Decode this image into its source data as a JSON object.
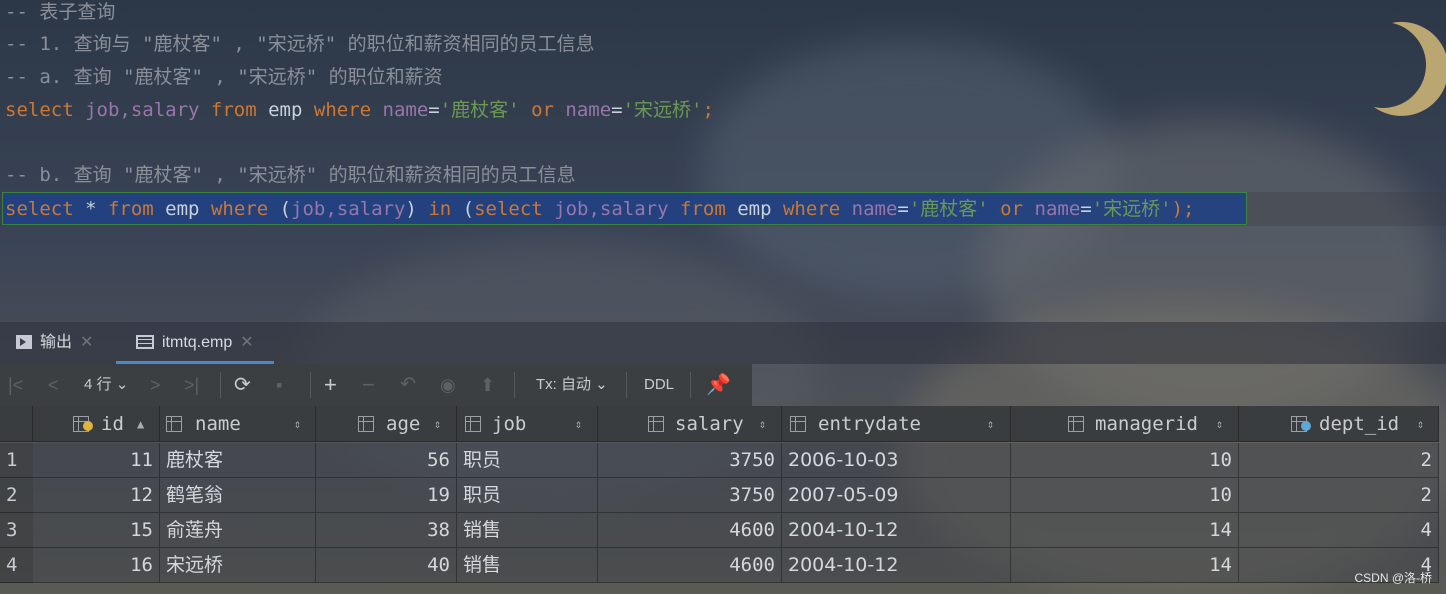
{
  "editor": {
    "comment1": "-- 表子查询",
    "comment2": "-- 1. 查询与 \"鹿杖客\" , \"宋远桥\" 的职位和薪资相同的员工信息",
    "comment3": "-- a. 查询 \"鹿杖客\" , \"宋远桥\" 的职位和薪资",
    "sql1": {
      "select": "select ",
      "cols": "job,salary",
      "from": " from ",
      "table": "emp",
      "where": " where ",
      "name1": "name",
      "eq1": "=",
      "v1": "'鹿杖客'",
      "or": " or ",
      "name2": "name",
      "eq2": "=",
      "v2": "'宋远桥'",
      "end": ";"
    },
    "comment4": "-- b. 查询 \"鹿杖客\" , \"宋远桥\" 的职位和薪资相同的员工信息",
    "sql2": {
      "select": "select",
      "star": " * ",
      "from": "from",
      "table": " emp ",
      "where": "where",
      "lp": " (",
      "cols": "job,salary",
      "rp": ") ",
      "in": "in",
      "lp2": " (",
      "select2": "select",
      "cols2": " job,salary ",
      "from2": "from",
      "table2": " emp ",
      "where2": "where",
      "name1": " name",
      "eq1": "=",
      "v1": "'鹿杖客'",
      "or": " or",
      "name2": " name",
      "eq2": "=",
      "v2": "'宋远桥'",
      "end": ");"
    }
  },
  "tabs": {
    "output": "输出",
    "table": "itmtq.emp"
  },
  "toolbar": {
    "rows": "4 行",
    "tx": "Tx: 自动",
    "ddl": "DDL"
  },
  "grid": {
    "columns": [
      "id",
      "name",
      "age",
      "job",
      "salary",
      "entrydate",
      "managerid",
      "dept_id"
    ],
    "rows": [
      {
        "n": "1",
        "id": "11",
        "name": "鹿杖客",
        "age": "56",
        "job": "职员",
        "salary": "3750",
        "entrydate": "2006-10-03",
        "managerid": "10",
        "dept_id": "2"
      },
      {
        "n": "2",
        "id": "12",
        "name": "鹤笔翁",
        "age": "19",
        "job": "职员",
        "salary": "3750",
        "entrydate": "2007-05-09",
        "managerid": "10",
        "dept_id": "2"
      },
      {
        "n": "3",
        "id": "15",
        "name": "俞莲舟",
        "age": "38",
        "job": "销售",
        "salary": "4600",
        "entrydate": "2004-10-12",
        "managerid": "14",
        "dept_id": "4"
      },
      {
        "n": "4",
        "id": "16",
        "name": "宋远桥",
        "age": "40",
        "job": "销售",
        "salary": "4600",
        "entrydate": "2004-10-12",
        "managerid": "14",
        "dept_id": "4"
      }
    ]
  },
  "watermark": "CSDN @洛-桥"
}
